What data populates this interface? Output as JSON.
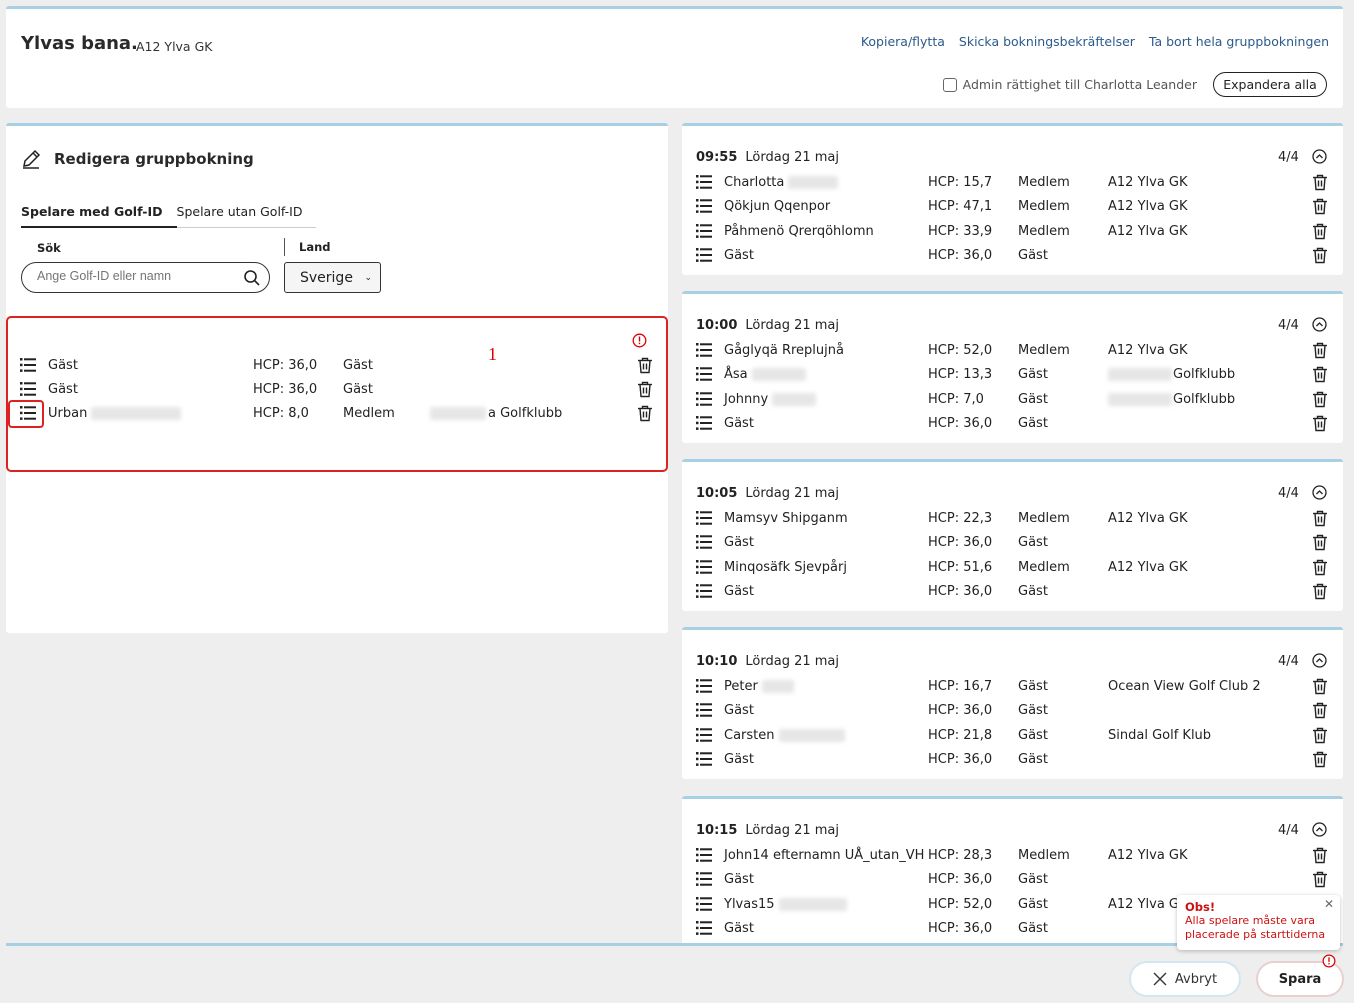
{
  "header": {
    "title": "Ylvas bana.",
    "subtitle": "A12 Ylva GK",
    "links": [
      "Kopiera/flytta",
      "Skicka bokningsbekräftelser",
      "Ta bort hela gruppbokningen"
    ],
    "admin_label": "Admin rättighet till Charlotta Leander",
    "admin_checked": false,
    "expand_label": "Expandera alla"
  },
  "edit": {
    "title": "Redigera gruppbokning",
    "tabs": [
      "Spelare med Golf-ID",
      "Spelare utan Golf-ID"
    ],
    "search_label": "Sök",
    "search_placeholder": "Ange Golf-ID eller namn",
    "country_label": "Land",
    "country_value": "Sverige",
    "badge": "1",
    "players": [
      {
        "name": "Gäst",
        "hcp": "HCP: 36,0",
        "type": "Gäst",
        "club": ""
      },
      {
        "name": "Gäst",
        "hcp": "HCP: 36,0",
        "type": "Gäst",
        "club": ""
      },
      {
        "name": "Urban",
        "hcp": "HCP: 8,0",
        "type": "Medlem",
        "club": "a Golfklubb"
      }
    ]
  },
  "teetimes": [
    {
      "time": "09:55",
      "date": "Lördag 21 maj",
      "count": "4/4",
      "players": [
        {
          "name": "Charlotta",
          "hcp": "HCP: 15,7",
          "type": "Medlem",
          "club": "A12 Ylva GK"
        },
        {
          "name": "Qökjun Qqenpor",
          "hcp": "HCP: 47,1",
          "type": "Medlem",
          "club": "A12 Ylva GK"
        },
        {
          "name": "Påhmenö Qrerqöhlomn",
          "hcp": "HCP: 33,9",
          "type": "Medlem",
          "club": "A12 Ylva GK"
        },
        {
          "name": "Gäst",
          "hcp": "HCP: 36,0",
          "type": "Gäst",
          "club": ""
        }
      ]
    },
    {
      "time": "10:00",
      "date": "Lördag 21 maj",
      "count": "4/4",
      "players": [
        {
          "name": "Gåglyqä Rreplujnå",
          "hcp": "HCP: 52,0",
          "type": "Medlem",
          "club": "A12 Ylva GK"
        },
        {
          "name": "Åsa",
          "hcp": "HCP: 13,3",
          "type": "Gäst",
          "club": "Golfklubb"
        },
        {
          "name": "Johnny",
          "hcp": "HCP: 7,0",
          "type": "Gäst",
          "club": "Golfklubb"
        },
        {
          "name": "Gäst",
          "hcp": "HCP: 36,0",
          "type": "Gäst",
          "club": ""
        }
      ]
    },
    {
      "time": "10:05",
      "date": "Lördag 21 maj",
      "count": "4/4",
      "players": [
        {
          "name": "Mamsyv Shipganm",
          "hcp": "HCP: 22,3",
          "type": "Medlem",
          "club": "A12 Ylva GK"
        },
        {
          "name": "Gäst",
          "hcp": "HCP: 36,0",
          "type": "Gäst",
          "club": ""
        },
        {
          "name": "Minqosäfk Sjevpårj",
          "hcp": "HCP: 51,6",
          "type": "Medlem",
          "club": "A12 Ylva GK"
        },
        {
          "name": "Gäst",
          "hcp": "HCP: 36,0",
          "type": "Gäst",
          "club": ""
        }
      ]
    },
    {
      "time": "10:10",
      "date": "Lördag 21 maj",
      "count": "4/4",
      "players": [
        {
          "name": "Peter",
          "hcp": "HCP: 16,7",
          "type": "Gäst",
          "club": "Ocean View Golf Club 2"
        },
        {
          "name": "Gäst",
          "hcp": "HCP: 36,0",
          "type": "Gäst",
          "club": ""
        },
        {
          "name": "Carsten",
          "hcp": "HCP: 21,8",
          "type": "Gäst",
          "club": "Sindal Golf Klub"
        },
        {
          "name": "Gäst",
          "hcp": "HCP: 36,0",
          "type": "Gäst",
          "club": ""
        }
      ]
    },
    {
      "time": "10:15",
      "date": "Lördag 21 maj",
      "count": "4/4",
      "players": [
        {
          "name": "John14 efternamn UÅ_utan_VH",
          "hcp": "HCP: 28,3",
          "type": "Medlem",
          "club": "A12 Ylva GK"
        },
        {
          "name": "Gäst",
          "hcp": "HCP: 36,0",
          "type": "Gäst",
          "club": ""
        },
        {
          "name": "Ylvas15",
          "hcp": "HCP: 52,0",
          "type": "Gäst",
          "club": "A12 Ylva GK"
        },
        {
          "name": "Gäst",
          "hcp": "HCP: 36,0",
          "type": "Gäst",
          "club": ""
        }
      ]
    }
  ],
  "toast": {
    "title": "Obs!",
    "message": "Alla spelare måste vara placerade på starttiderna"
  },
  "footer": {
    "cancel_label": "Avbryt",
    "save_label": "Spara"
  },
  "colors": {
    "accent_border": "#a8cfe3",
    "error": "#dd2222",
    "link": "#2c5a8a"
  },
  "icons": [
    "pencil-icon",
    "search-icon",
    "list-icon",
    "trash-icon",
    "chevron-up-icon",
    "alert-icon",
    "close-icon"
  ]
}
